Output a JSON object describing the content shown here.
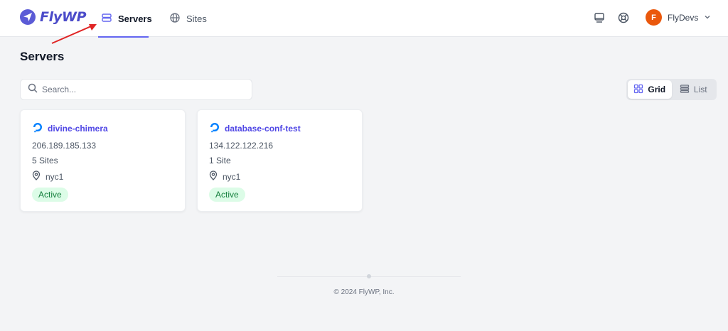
{
  "brand": {
    "name": "FlyWP",
    "icon": "paper-plane-logo-icon",
    "color": "#4b4bc9"
  },
  "nav": {
    "tabs": [
      {
        "label": "Servers",
        "icon": "server-icon",
        "active": true
      },
      {
        "label": "Sites",
        "icon": "globe-icon",
        "active": false
      }
    ]
  },
  "header": {
    "icons": [
      "monitor-icon",
      "support-icon"
    ],
    "user": {
      "initial": "F",
      "name": "FlyDevs",
      "avatar_color": "#ea580c"
    }
  },
  "page": {
    "title": "Servers"
  },
  "search": {
    "placeholder": "Search..."
  },
  "view_toggle": {
    "options": [
      {
        "label": "Grid",
        "icon": "grid-icon",
        "active": true
      },
      {
        "label": "List",
        "icon": "list-icon",
        "active": false
      }
    ]
  },
  "servers": [
    {
      "name": "divine-chimera",
      "ip": "206.189.185.133",
      "sites": "5 Sites",
      "region": "nyc1",
      "status": "Active",
      "provider_icon": "digitalocean-icon"
    },
    {
      "name": "database-conf-test",
      "ip": "134.122.122.216",
      "sites": "1 Site",
      "region": "nyc1",
      "status": "Active",
      "provider_icon": "digitalocean-icon"
    }
  ],
  "footer": {
    "copyright": "© 2024 FlyWP, Inc."
  },
  "colors": {
    "accent": "#6366f1",
    "status_active_bg": "#dcfce7",
    "status_active_text": "#15803d",
    "annotation_arrow": "#e02424"
  }
}
